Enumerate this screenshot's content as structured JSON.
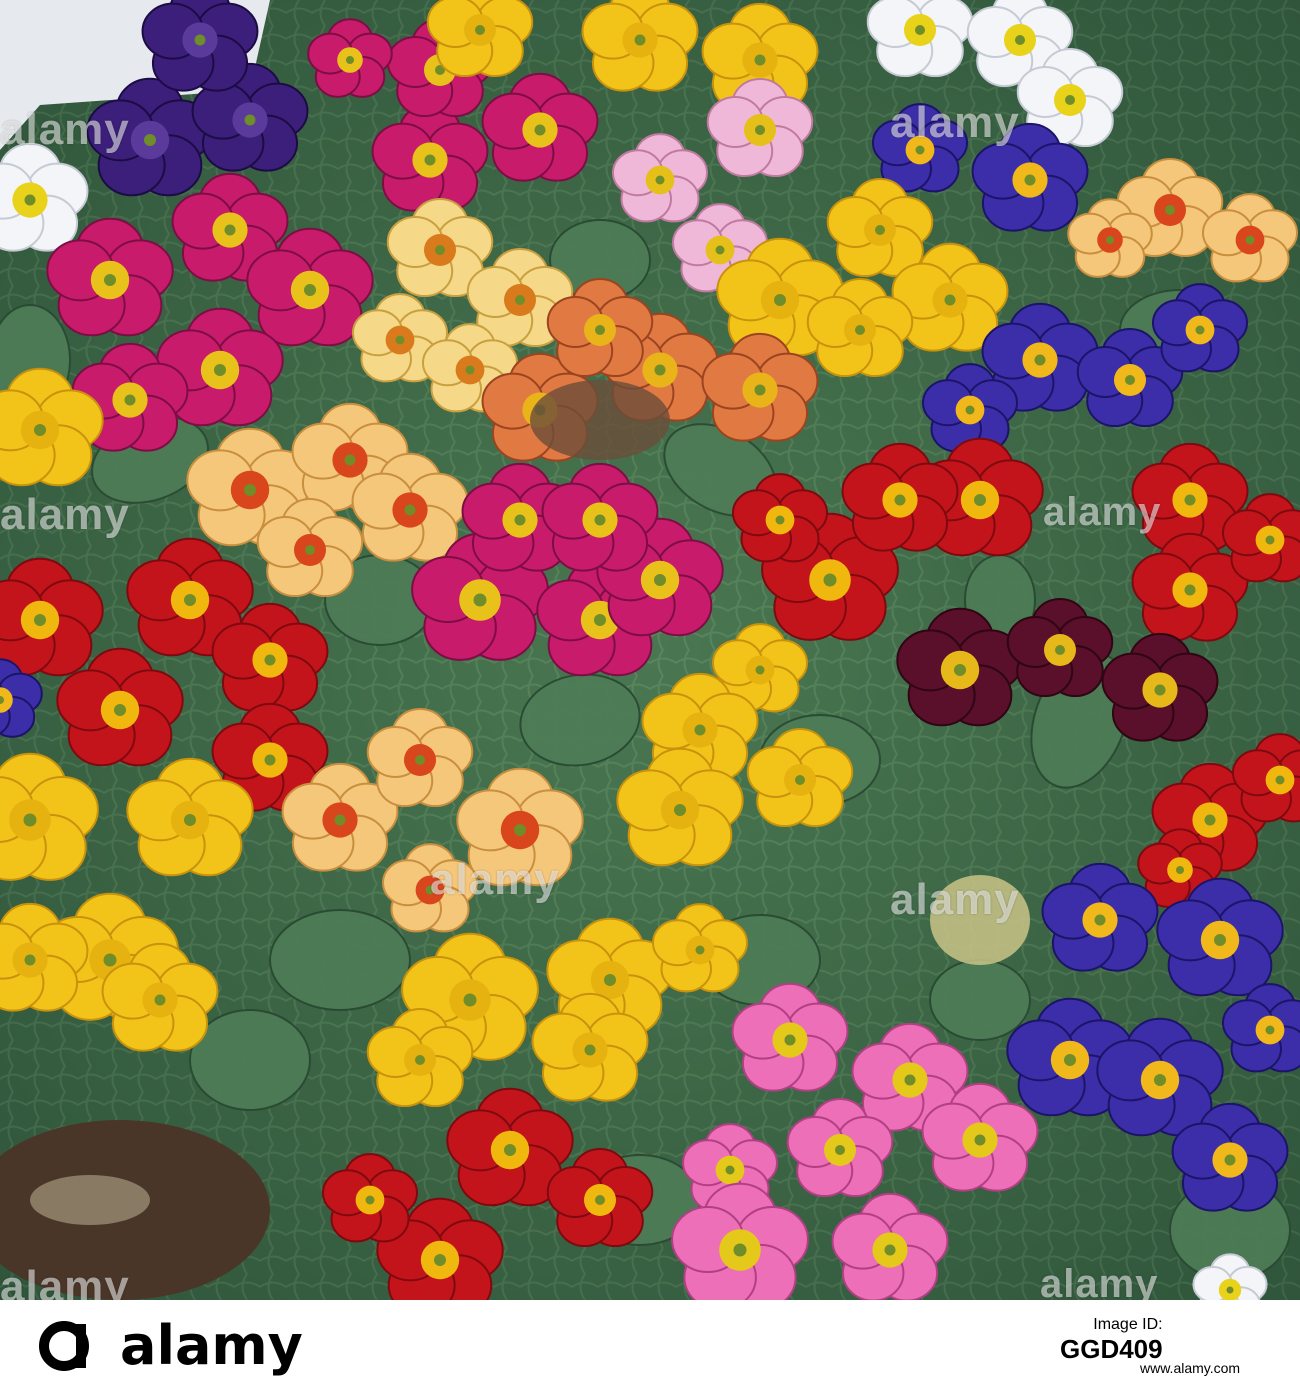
{
  "photo": {
    "description_colors": {
      "leaf_green": "#3f6b45",
      "soil_brown": "#4a3628",
      "wall_white": "#e9ecef"
    }
  },
  "watermarks": {
    "text": "alamy"
  },
  "footer": {
    "logo_letter": "a",
    "stock_label": "alamy",
    "id_label": "Image ID:",
    "image_id": "GGD409",
    "url": "www.alamy.com"
  }
}
